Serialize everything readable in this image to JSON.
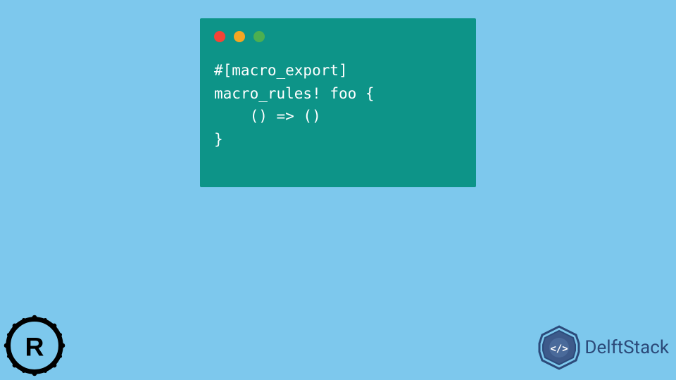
{
  "code": {
    "line1": "#[macro_export]",
    "line2": "macro_rules! foo {",
    "line3": "    () => ()",
    "line4": "}"
  },
  "branding": {
    "text": "DelftStack"
  },
  "colors": {
    "background": "#7dc8ed",
    "codeWindow": "#0d9488",
    "dotRed": "#f44336",
    "dotYellow": "#f5a623",
    "dotGreen": "#4caf50",
    "logoBlue": "#2c4a7a"
  }
}
